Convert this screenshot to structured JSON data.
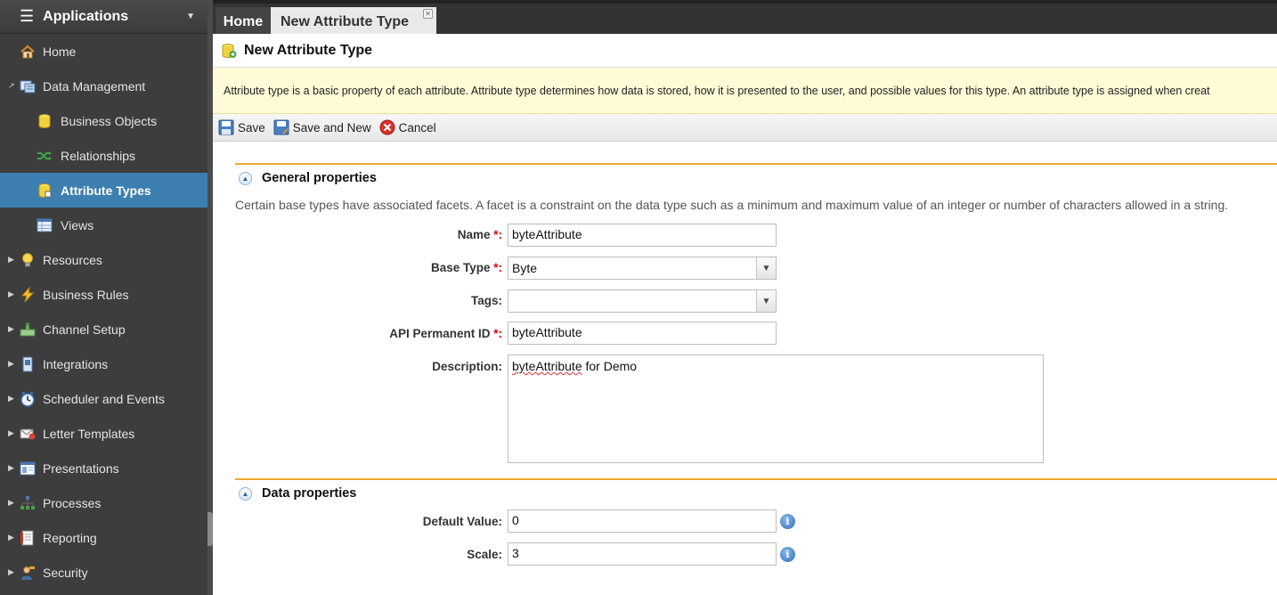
{
  "sidebar": {
    "title": "Applications",
    "items": [
      {
        "label": "Home",
        "icon": "house-icon"
      },
      {
        "label": "Data Management",
        "icon": "data-management-icon",
        "expanded": true
      },
      {
        "label": "Business Objects",
        "icon": "database-icon"
      },
      {
        "label": "Relationships",
        "icon": "shuffle-icon"
      },
      {
        "label": "Attribute Types",
        "icon": "database-edit-icon",
        "active": true
      },
      {
        "label": "Views",
        "icon": "table-icon"
      },
      {
        "label": "Resources",
        "icon": "lightbulb-icon"
      },
      {
        "label": "Business Rules",
        "icon": "lightning-icon"
      },
      {
        "label": "Channel Setup",
        "icon": "channel-icon"
      },
      {
        "label": "Integrations",
        "icon": "integration-icon"
      },
      {
        "label": "Scheduler and Events",
        "icon": "clock-icon"
      },
      {
        "label": "Letter Templates",
        "icon": "letter-icon"
      },
      {
        "label": "Presentations",
        "icon": "presentation-icon"
      },
      {
        "label": "Processes",
        "icon": "process-icon"
      },
      {
        "label": "Reporting",
        "icon": "report-icon"
      },
      {
        "label": "Security",
        "icon": "user-icon"
      }
    ]
  },
  "tabs": [
    {
      "label": "Home"
    },
    {
      "label": "New Attribute Type",
      "active": true
    }
  ],
  "page": {
    "title": "New Attribute Type",
    "info": "Attribute type is a basic property of each attribute. Attribute type determines how data is stored, how it is presented to the user, and possible values for this type. An attribute type is assigned when creat"
  },
  "toolbar": {
    "save": "Save",
    "save_new": "Save and New",
    "cancel": "Cancel"
  },
  "general": {
    "title": "General properties",
    "note": "Certain base types have associated facets. A facet is a constraint on the data type such as a minimum and maximum value of an integer or number of characters allowed in a string.",
    "name_label": "Name",
    "name_value": "byteAttribute",
    "base_type_label": "Base Type",
    "base_type_value": "Byte",
    "tags_label": "Tags:",
    "tags_value": "",
    "api_label": "API Permanent ID",
    "api_value": "byteAttribute",
    "desc_label": "Description:",
    "desc_word1": "byteAttribute",
    "desc_rest": " for Demo",
    "required_mark": "*:"
  },
  "data_props": {
    "title": "Data properties",
    "default_label": "Default Value:",
    "default_value": "0",
    "scale_label": "Scale:",
    "scale_value": "3",
    "info_glyph": "i"
  },
  "colors": {
    "accent": "#f0a830",
    "active_nav": "#3c7fb0",
    "info_bg": "#fffbd6"
  }
}
